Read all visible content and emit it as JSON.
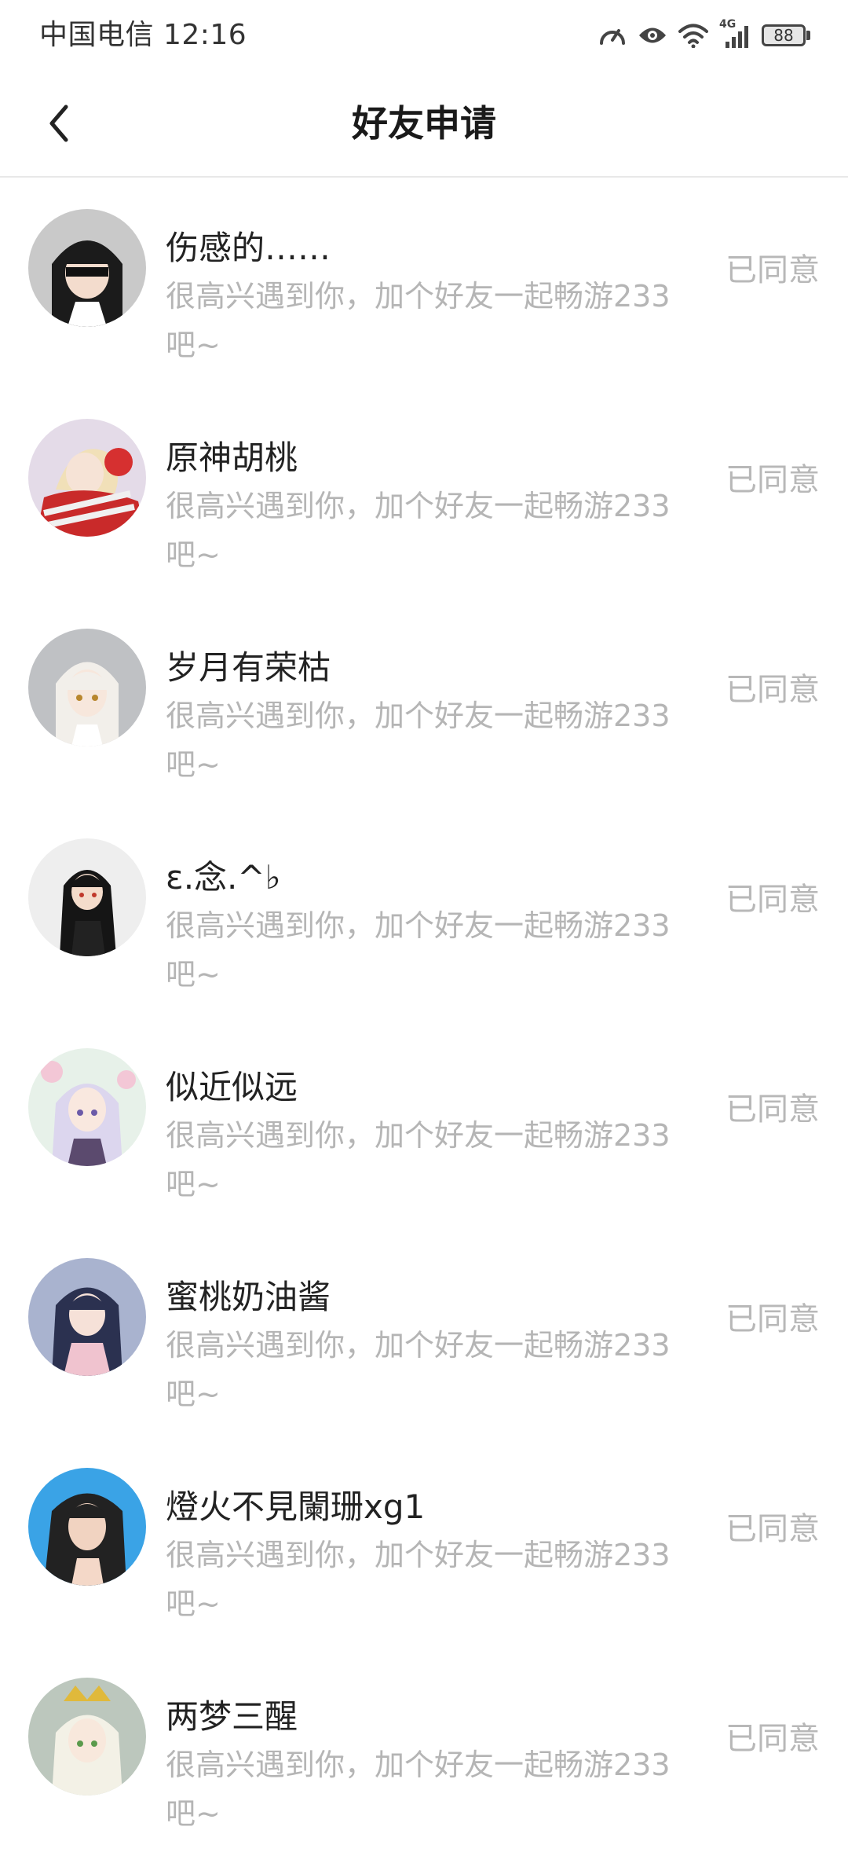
{
  "status_bar": {
    "carrier": "中国电信",
    "time": "12:16",
    "network": "4G",
    "battery": "88"
  },
  "header": {
    "title": "好友申请",
    "back_icon": "chevron-left-icon"
  },
  "requests": [
    {
      "nickname": "伤感的……",
      "message": "很高兴遇到你，加个好友一起畅游233吧~",
      "status": "已同意"
    },
    {
      "nickname": "原神胡桃",
      "message": "很高兴遇到你，加个好友一起畅游233吧~",
      "status": "已同意"
    },
    {
      "nickname": "岁月有荣枯",
      "message": "很高兴遇到你，加个好友一起畅游233吧~",
      "status": "已同意"
    },
    {
      "nickname": "ε.念.^♭",
      "message": "很高兴遇到你，加个好友一起畅游233吧~",
      "status": "已同意"
    },
    {
      "nickname": "似近似远",
      "message": "很高兴遇到你，加个好友一起畅游233吧~",
      "status": "已同意"
    },
    {
      "nickname": "蜜桃奶油酱",
      "message": "很高兴遇到你，加个好友一起畅游233吧~",
      "status": "已同意"
    },
    {
      "nickname": "燈火不見闌珊xg1",
      "message": "很高兴遇到你，加个好友一起畅游233吧~",
      "status": "已同意"
    },
    {
      "nickname": "两梦三醒",
      "message": "很高兴遇到你，加个好友一起畅游233吧~",
      "status": "已同意"
    }
  ],
  "colors": {
    "text_primary": "#222222",
    "text_secondary": "#b5b5b5",
    "status_text": "#b8b8b8",
    "divider": "#e8e8e8",
    "background": "#ffffff"
  }
}
